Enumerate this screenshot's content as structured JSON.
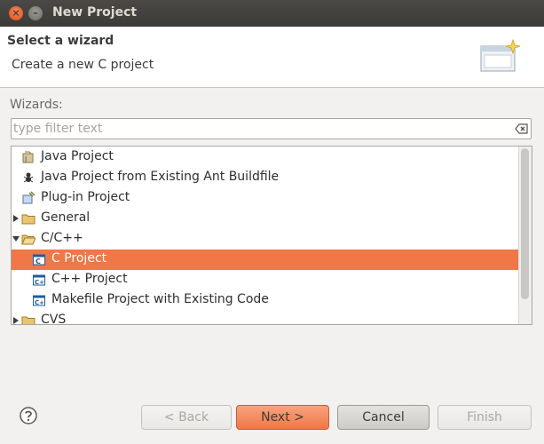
{
  "window": {
    "title": "New Project",
    "close_glyph": "×",
    "min_glyph": "–"
  },
  "header": {
    "title": "Select a wizard",
    "description": "Create a new C project",
    "banner_icon": "wizard-banner-icon"
  },
  "wizards_label": "Wizards:",
  "filter": {
    "placeholder": "type filter text",
    "value": ""
  },
  "tree": {
    "selected_index": 5,
    "items": [
      {
        "label": "Java Project",
        "icon": "java-project-icon",
        "expander": "none"
      },
      {
        "label": "Java Project from Existing Ant Buildfile",
        "icon": "ant-icon",
        "expander": "none"
      },
      {
        "label": "Plug-in Project",
        "icon": "plugin-project-icon",
        "expander": "none"
      },
      {
        "label": "General",
        "icon": "folder-icon",
        "expander": "collapsed"
      },
      {
        "label": "C/C++",
        "icon": "folder-open-icon",
        "expander": "expanded"
      },
      {
        "label": "C Project",
        "icon": "c-project-icon",
        "expander": "none"
      },
      {
        "label": "C++ Project",
        "icon": "cpp-project-icon",
        "expander": "none"
      },
      {
        "label": "Makefile Project with Existing Code",
        "icon": "makefile-project-icon",
        "expander": "none"
      },
      {
        "label": "CVS",
        "icon": "folder-icon",
        "expander": "collapsed"
      }
    ]
  },
  "buttons": {
    "back": "< Back",
    "next": "Next >",
    "cancel": "Cancel",
    "finish": "Finish"
  },
  "colors": {
    "selection": "#f07746",
    "titlebar": "#3c3b37",
    "accent": "#df4a16"
  }
}
